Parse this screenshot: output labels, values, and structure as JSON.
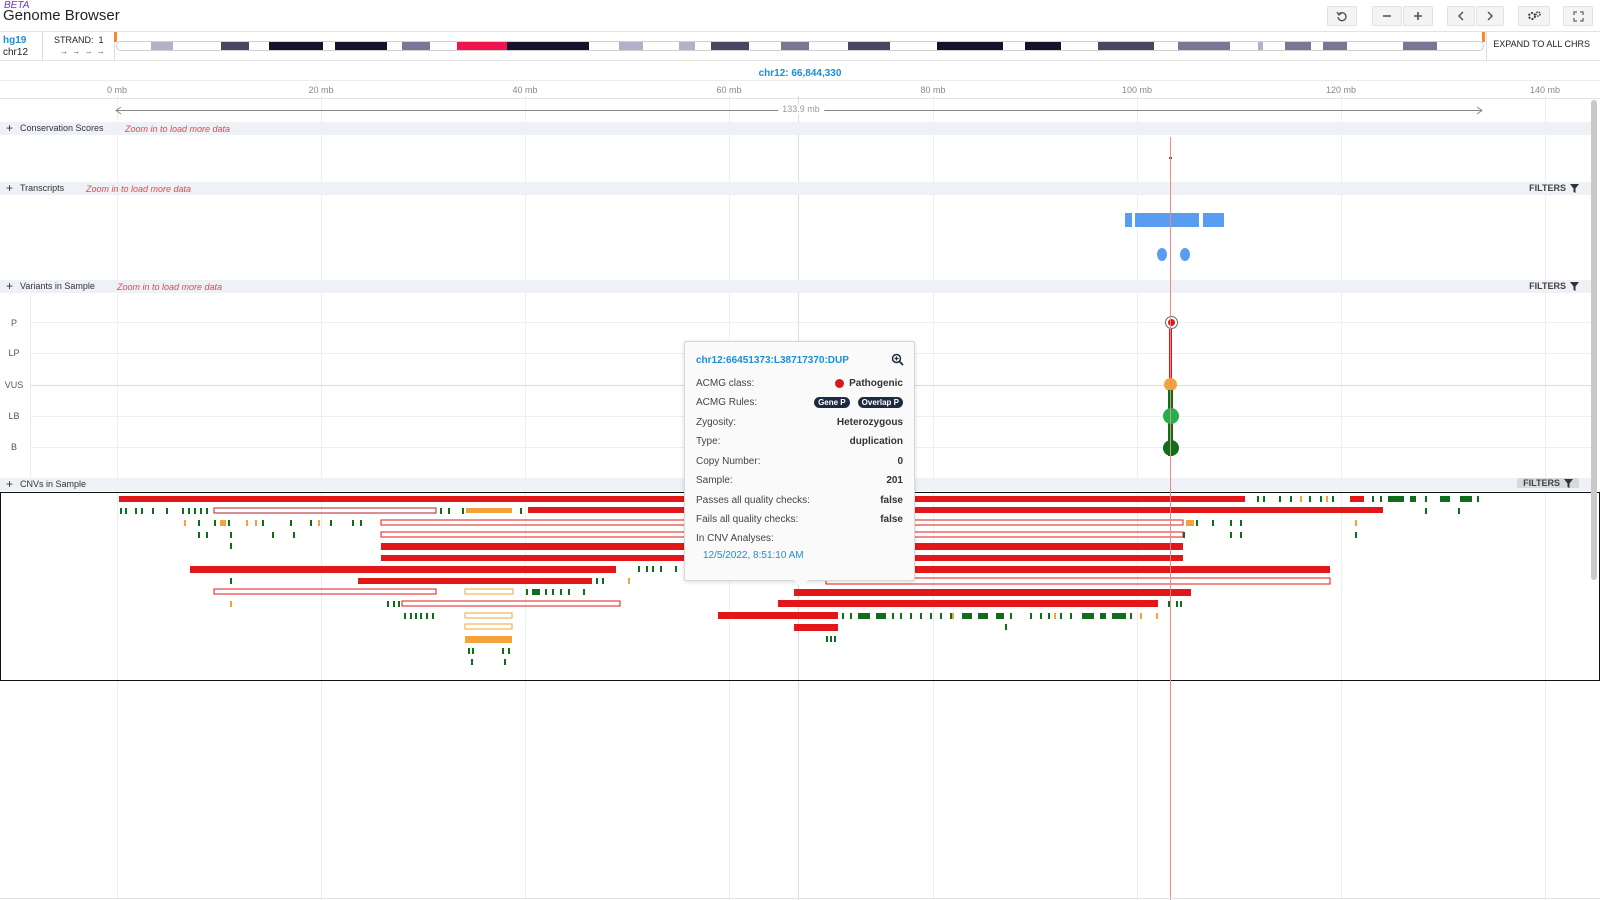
{
  "header": {
    "beta": "BETA",
    "title": "Genome Browser",
    "buttons": [
      "undo-icon",
      "zoom-out-icon",
      "zoom-in-icon",
      "chevron-left-icon",
      "chevron-right-icon",
      "settings-icon",
      "fullscreen-icon"
    ]
  },
  "location": {
    "assembly": "hg19",
    "chromosome": "chr12",
    "strand_label": "STRAND:",
    "strand_value": "1",
    "strand_arrows": "→ → → →",
    "expand_label": "EXPAND TO ALL CHRS"
  },
  "ruler": {
    "locus": "chr12: 66,844,330",
    "ticks": [
      "0 mb",
      "20 mb",
      "40 mb",
      "60 mb",
      "80 mb",
      "100 mb",
      "120 mb",
      "140 mb"
    ],
    "span": "133.9 mb"
  },
  "tracks": {
    "conservation": {
      "name": "Conservation Scores",
      "note": "Zoom in to load more data"
    },
    "transcripts": {
      "name": "Transcripts",
      "note": "Zoom in to load more data",
      "filters": "FILTERS"
    },
    "variants": {
      "name": "Variants in Sample",
      "note": "Zoom in to load more data",
      "filters": "FILTERS",
      "levels": [
        "P",
        "LP",
        "VUS",
        "LB",
        "B"
      ]
    },
    "cnvs": {
      "name": "CNVs in Sample",
      "filters": "FILTERS"
    }
  },
  "tooltip": {
    "title": "chr12:66451373:L38717370:DUP",
    "rows": [
      {
        "key": "ACMG class:",
        "value": "Pathogenic"
      },
      {
        "key": "ACMG Rules:",
        "value": ""
      },
      {
        "key": "Zygosity:",
        "value": "Heterozygous"
      },
      {
        "key": "Type:",
        "value": "duplication"
      },
      {
        "key": "Copy Number:",
        "value": "0"
      },
      {
        "key": "Sample:",
        "value": "201"
      },
      {
        "key": "Passes all quality checks:",
        "value": "false"
      },
      {
        "key": "Fails all quality checks:",
        "value": "false"
      },
      {
        "key": "In CNV Analyses:",
        "value": ""
      }
    ],
    "rules": [
      "Gene P",
      "Overlap P"
    ],
    "date": "12/5/2022, 8:51:10 AM"
  },
  "colors": {
    "accent": "#1a8fd8",
    "pathogenic": "#d6191b",
    "vus": "#f3a33a",
    "likely_benign": "#22b04b",
    "benign": "#0f6e1c",
    "transcript": "#4a90e2"
  }
}
